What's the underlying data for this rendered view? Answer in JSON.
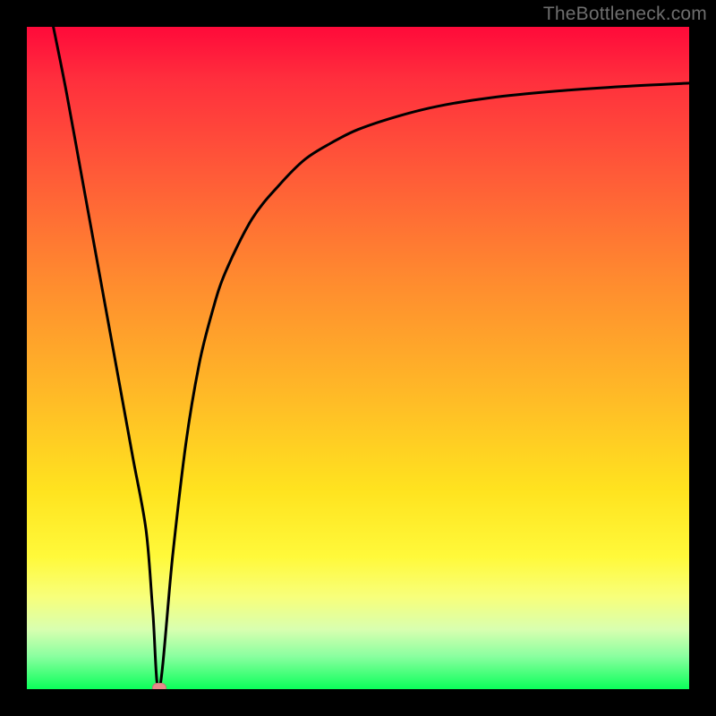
{
  "watermark": "TheBottleneck.com",
  "chart_data": {
    "type": "line",
    "title": "",
    "xlabel": "",
    "ylabel": "",
    "xlim": [
      0,
      100
    ],
    "ylim": [
      0,
      100
    ],
    "grid": false,
    "legend": false,
    "series": [
      {
        "name": "bottleneck-curve",
        "x": [
          4,
          6,
          8,
          10,
          12,
          14,
          16,
          18,
          19,
          20,
          22,
          24,
          26,
          28,
          30,
          34,
          38,
          42,
          46,
          50,
          56,
          62,
          70,
          80,
          90,
          100
        ],
        "values": [
          100,
          90,
          79,
          68,
          57,
          46,
          35,
          24,
          12,
          0,
          20,
          37,
          49,
          57,
          63,
          71,
          76,
          80,
          82.5,
          84.5,
          86.5,
          88,
          89.3,
          90.3,
          91,
          91.5
        ]
      }
    ],
    "annotations": [
      {
        "type": "marker",
        "name": "min-point",
        "x": 20,
        "y": 0
      }
    ],
    "colors": {
      "curve": "#000000",
      "marker": "#e88b8b",
      "gradient_top": "#ff0a3a",
      "gradient_mid": "#ffe31f",
      "gradient_bottom": "#0bff5a"
    }
  }
}
